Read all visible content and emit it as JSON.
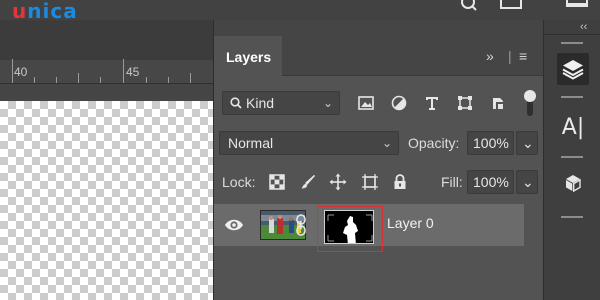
{
  "brand": {
    "logo_u": "u",
    "logo_rest": "nica"
  },
  "ruler": {
    "labels": [
      "40",
      "45"
    ]
  },
  "layers_panel": {
    "tab_label": "Layers",
    "menu_glyphs": {
      "expand": "»",
      "divider": "|",
      "menu": "≡"
    },
    "filter": {
      "label": "Kind",
      "chevron": "⌄"
    },
    "blend_mode": {
      "value": "Normal",
      "chevron": "⌄"
    },
    "opacity": {
      "label": "Opacity:",
      "value": "100%",
      "chevron": "⌄"
    },
    "lock": {
      "label": "Lock:"
    },
    "fill": {
      "label": "Fill:",
      "value": "100%",
      "chevron": "⌄"
    },
    "layers": [
      {
        "name": "Layer 0"
      }
    ]
  },
  "right_strip": {
    "collapse": "‹‹",
    "character_label": "A|"
  },
  "colors": {
    "panel_bg": "#535353",
    "layer_selected_bg": "#6b6b6b",
    "mask_highlight": "#d93030",
    "logo_red": "#e5343a",
    "logo_blue": "#1a8be0"
  }
}
